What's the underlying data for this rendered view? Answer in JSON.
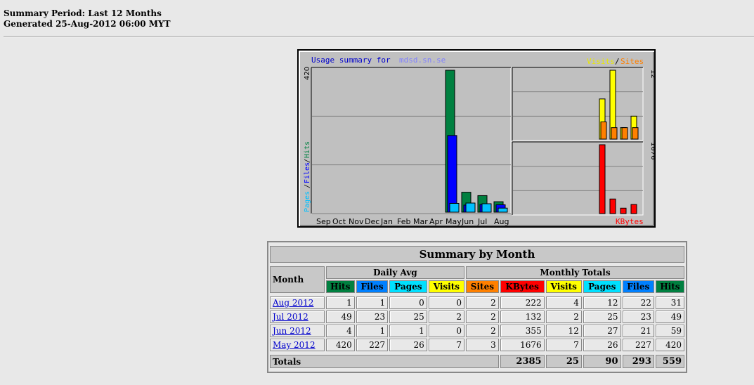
{
  "header": {
    "period": "Summary Period: Last 12 Months",
    "generated": "Generated 25-Aug-2012 06:00 MYT"
  },
  "chart": {
    "title_prefix": "Usage summary for",
    "site_name": "mdsd.sn.se",
    "legend_visits": "Visits",
    "legend_sep": "/",
    "legend_sites": "Sites",
    "left_axis_max": "420",
    "right_top_max": "12",
    "right_bottom_max": "1676",
    "left_label_pages": "Pages",
    "left_label_files": "Files",
    "left_label_hits": "Hits",
    "kbytes_label": "KBytes",
    "months": [
      "Sep",
      "Oct",
      "Nov",
      "Dec",
      "Jan",
      "Feb",
      "Mar",
      "Apr",
      "May",
      "Jun",
      "Jul",
      "Aug"
    ],
    "colors": {
      "hits": "#008040",
      "files": "#0000ff",
      "pages": "#00c0ff",
      "visits": "#ffff00",
      "sites": "#ff8000",
      "kbytes": "#ff0000"
    }
  },
  "chart_data": {
    "type": "bar",
    "categories": [
      "Sep",
      "Oct",
      "Nov",
      "Dec",
      "Jan",
      "Feb",
      "Mar",
      "Apr",
      "May",
      "Jun",
      "Jul",
      "Aug"
    ],
    "series": [
      {
        "name": "Hits",
        "values": [
          0,
          0,
          0,
          0,
          0,
          0,
          0,
          0,
          420,
          59,
          49,
          31
        ]
      },
      {
        "name": "Files",
        "values": [
          0,
          0,
          0,
          0,
          0,
          0,
          0,
          0,
          227,
          21,
          23,
          22
        ]
      },
      {
        "name": "Pages",
        "values": [
          0,
          0,
          0,
          0,
          0,
          0,
          0,
          0,
          26,
          27,
          25,
          12
        ]
      },
      {
        "name": "Visits",
        "values": [
          0,
          0,
          0,
          0,
          0,
          0,
          0,
          0,
          7,
          12,
          2,
          4
        ]
      },
      {
        "name": "Sites",
        "values": [
          0,
          0,
          0,
          0,
          0,
          0,
          0,
          0,
          3,
          2,
          2,
          2
        ]
      },
      {
        "name": "KBytes",
        "values": [
          0,
          0,
          0,
          0,
          0,
          0,
          0,
          0,
          1676,
          355,
          132,
          222
        ]
      }
    ],
    "ylim_hits": [
      0,
      420
    ],
    "ylim_visits": [
      0,
      12
    ],
    "ylim_kbytes": [
      0,
      1676
    ]
  },
  "table": {
    "title": "Summary by Month",
    "month_header": "Month",
    "daily_avg": "Daily Avg",
    "monthly_totals": "Monthly Totals",
    "cols": [
      "Hits",
      "Files",
      "Pages",
      "Visits",
      "Sites",
      "KBytes",
      "Visits",
      "Pages",
      "Files",
      "Hits"
    ],
    "col_colors": [
      "#008040",
      "#0080ff",
      "#00e0ff",
      "#ffff00",
      "#ff8000",
      "#ff0000",
      "#ffff00",
      "#00e0ff",
      "#0080ff",
      "#008040"
    ],
    "rows": [
      {
        "month": "Aug 2012",
        "values": [
          "1",
          "1",
          "0",
          "0",
          "2",
          "222",
          "4",
          "12",
          "22",
          "31"
        ]
      },
      {
        "month": "Jul 2012",
        "values": [
          "49",
          "23",
          "25",
          "2",
          "2",
          "132",
          "2",
          "25",
          "23",
          "49"
        ]
      },
      {
        "month": "Jun 2012",
        "values": [
          "4",
          "1",
          "1",
          "0",
          "2",
          "355",
          "12",
          "27",
          "21",
          "59"
        ]
      },
      {
        "month": "May 2012",
        "values": [
          "420",
          "227",
          "26",
          "7",
          "3",
          "1676",
          "7",
          "26",
          "227",
          "420"
        ]
      }
    ],
    "totals_label": "Totals",
    "totals": [
      "2385",
      "25",
      "90",
      "293",
      "559"
    ]
  }
}
